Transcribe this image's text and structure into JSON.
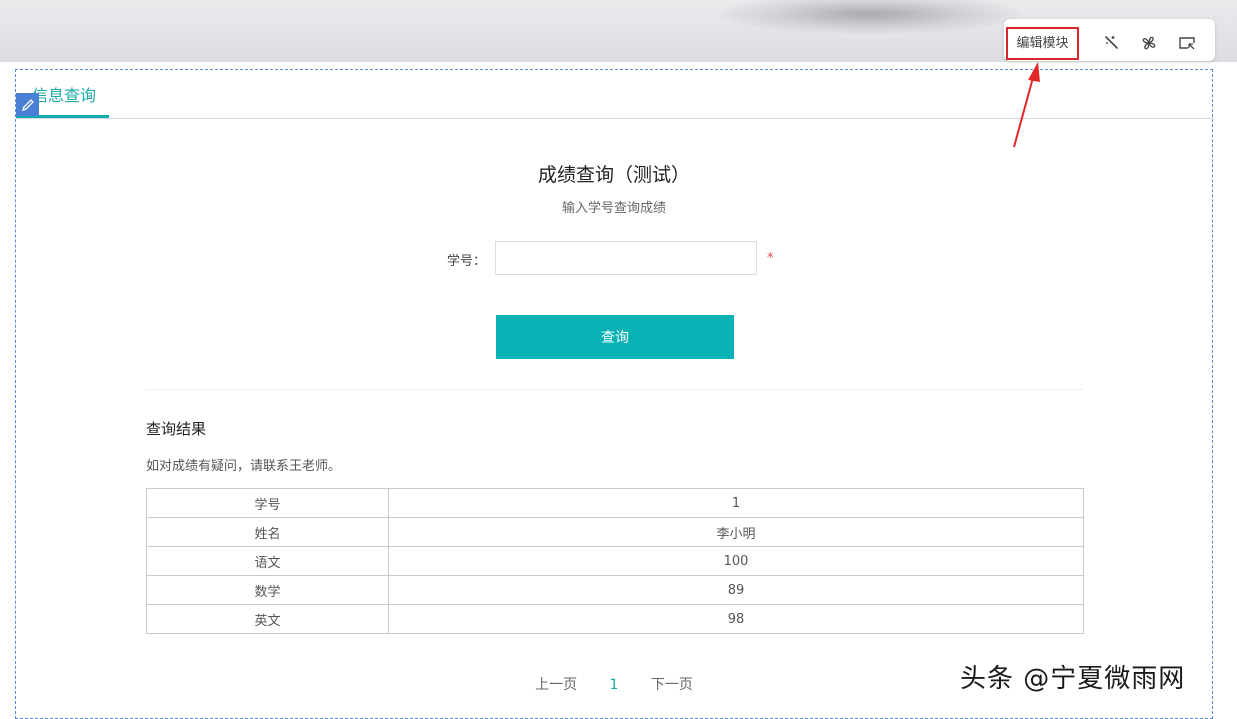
{
  "toolbar": {
    "edit_label": "编辑模块",
    "icons": [
      "magic-wand-icon",
      "pinwheel-icon",
      "screen-cursor-icon"
    ],
    "highlight_color": "#d6262c"
  },
  "tab": {
    "label": "信息查询",
    "accent_color": "#1aa9a9"
  },
  "form": {
    "title": "成绩查询（测试）",
    "subtitle": "输入学号查询成绩",
    "field_label": "学号：",
    "field_value": "",
    "required_mark": "*",
    "submit_label": "查询",
    "button_color": "#06b2b6"
  },
  "result": {
    "heading": "查询结果",
    "note": "如对成绩有疑问，请联系王老师。",
    "rows": [
      {
        "key": "学号",
        "value": "1"
      },
      {
        "key": "姓名",
        "value": "李小明"
      },
      {
        "key": "语文",
        "value": "100"
      },
      {
        "key": "数学",
        "value": "89"
      },
      {
        "key": "英文",
        "value": "98"
      }
    ]
  },
  "pager": {
    "prev": "上一页",
    "current": "1",
    "next": "下一页"
  },
  "watermark": "头条 @宁夏微雨网"
}
